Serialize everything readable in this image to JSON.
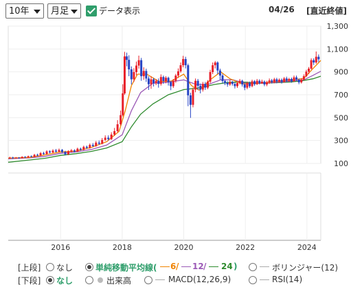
{
  "toolbar": {
    "range_value": "10年",
    "period_value": "月足",
    "data_display_label": "データ表示",
    "date": "04/26",
    "price_basis": "[直近終値]"
  },
  "chart_data": {
    "type": "candlestick",
    "ylim": [
      100,
      1300
    ],
    "yticks": [
      "1,300",
      "1,100",
      "900",
      "700",
      "500",
      "300",
      "100"
    ],
    "xticks": [
      "2016",
      "2018",
      "2020",
      "2022",
      "2024"
    ],
    "x_start": 2014.3,
    "x_end": 2024.45,
    "series": [
      {
        "name": "6",
        "color": "#f08300"
      },
      {
        "name": "12",
        "color": "#9b59b6"
      },
      {
        "name": "24",
        "color": "#2e8b2e"
      }
    ],
    "candles": [
      [
        2014.35,
        148,
        152,
        140,
        158
      ],
      [
        2014.45,
        152,
        146,
        140,
        158
      ],
      [
        2014.55,
        146,
        151,
        142,
        156
      ],
      [
        2014.65,
        151,
        147,
        143,
        155
      ],
      [
        2014.75,
        147,
        158,
        144,
        162
      ],
      [
        2014.85,
        158,
        152,
        149,
        163
      ],
      [
        2014.95,
        152,
        163,
        150,
        168
      ],
      [
        2015.05,
        163,
        158,
        154,
        170
      ],
      [
        2015.15,
        158,
        175,
        155,
        183
      ],
      [
        2015.25,
        175,
        168,
        164,
        185
      ],
      [
        2015.35,
        168,
        190,
        165,
        200
      ],
      [
        2015.45,
        190,
        182,
        176,
        202
      ],
      [
        2015.55,
        182,
        205,
        178,
        215
      ],
      [
        2015.65,
        205,
        196,
        188,
        215
      ],
      [
        2015.75,
        196,
        212,
        190,
        224
      ],
      [
        2015.85,
        212,
        203,
        195,
        226
      ],
      [
        2015.95,
        203,
        218,
        198,
        230
      ],
      [
        2016.05,
        218,
        200,
        192,
        226
      ],
      [
        2016.15,
        200,
        180,
        170,
        210
      ],
      [
        2016.25,
        180,
        205,
        172,
        215
      ],
      [
        2016.35,
        205,
        214,
        196,
        226
      ],
      [
        2016.45,
        214,
        204,
        196,
        224
      ],
      [
        2016.55,
        204,
        228,
        200,
        238
      ],
      [
        2016.65,
        228,
        220,
        212,
        238
      ],
      [
        2016.75,
        220,
        245,
        214,
        255
      ],
      [
        2016.85,
        245,
        236,
        226,
        256
      ],
      [
        2016.95,
        236,
        262,
        230,
        274
      ],
      [
        2017.05,
        262,
        252,
        244,
        278
      ],
      [
        2017.15,
        252,
        282,
        246,
        296
      ],
      [
        2017.25,
        282,
        272,
        262,
        300
      ],
      [
        2017.35,
        272,
        305,
        266,
        322
      ],
      [
        2017.45,
        305,
        325,
        296,
        345
      ],
      [
        2017.55,
        325,
        312,
        300,
        345
      ],
      [
        2017.65,
        312,
        352,
        305,
        372
      ],
      [
        2017.75,
        352,
        382,
        340,
        410
      ],
      [
        2017.85,
        382,
        442,
        370,
        478
      ],
      [
        2017.95,
        442,
        522,
        430,
        562
      ],
      [
        2018.02,
        522,
        712,
        510,
        792
      ],
      [
        2018.08,
        712,
        1035,
        700,
        1075
      ],
      [
        2018.15,
        1035,
        1005,
        948,
        1068
      ],
      [
        2018.22,
        1005,
        922,
        862,
        1045
      ],
      [
        2018.3,
        922,
        835,
        790,
        948
      ],
      [
        2018.38,
        835,
        898,
        812,
        932
      ],
      [
        2018.46,
        898,
        955,
        870,
        990
      ],
      [
        2018.54,
        955,
        1002,
        928,
        1042
      ],
      [
        2018.62,
        1002,
        862,
        822,
        1022
      ],
      [
        2018.7,
        862,
        908,
        830,
        940
      ],
      [
        2018.78,
        908,
        842,
        812,
        928
      ],
      [
        2018.86,
        842,
        792,
        742,
        862
      ],
      [
        2018.94,
        792,
        835,
        752,
        862
      ],
      [
        2019.02,
        835,
        802,
        772,
        848
      ],
      [
        2019.1,
        802,
        822,
        784,
        838
      ],
      [
        2019.18,
        822,
        795,
        762,
        842
      ],
      [
        2019.26,
        795,
        855,
        780,
        878
      ],
      [
        2019.34,
        855,
        820,
        795,
        868
      ],
      [
        2019.42,
        820,
        848,
        800,
        862
      ],
      [
        2019.5,
        848,
        810,
        780,
        858
      ],
      [
        2019.58,
        810,
        775,
        740,
        822
      ],
      [
        2019.66,
        775,
        822,
        760,
        838
      ],
      [
        2019.74,
        822,
        868,
        805,
        882
      ],
      [
        2019.82,
        868,
        905,
        848,
        930
      ],
      [
        2019.9,
        905,
        958,
        892,
        982
      ],
      [
        2019.98,
        958,
        1012,
        940,
        1040
      ],
      [
        2020.06,
        1012,
        958,
        930,
        1032
      ],
      [
        2020.14,
        958,
        695,
        600,
        972
      ],
      [
        2020.22,
        695,
        612,
        498,
        718
      ],
      [
        2020.3,
        612,
        745,
        590,
        762
      ],
      [
        2020.38,
        745,
        822,
        722,
        842
      ],
      [
        2020.46,
        822,
        778,
        742,
        838
      ],
      [
        2020.54,
        778,
        745,
        712,
        798
      ],
      [
        2020.62,
        745,
        795,
        728,
        812
      ],
      [
        2020.7,
        795,
        762,
        742,
        812
      ],
      [
        2020.78,
        762,
        815,
        748,
        828
      ],
      [
        2020.86,
        815,
        898,
        802,
        918
      ],
      [
        2020.94,
        898,
        958,
        880,
        982
      ],
      [
        2021.02,
        958,
        982,
        930,
        995
      ],
      [
        2021.1,
        982,
        912,
        880,
        992
      ],
      [
        2021.18,
        912,
        868,
        832,
        928
      ],
      [
        2021.26,
        868,
        820,
        800,
        882
      ],
      [
        2021.34,
        820,
        802,
        784,
        832
      ],
      [
        2021.42,
        802,
        790,
        770,
        818
      ],
      [
        2021.5,
        790,
        812,
        778,
        828
      ],
      [
        2021.58,
        812,
        795,
        780,
        822
      ],
      [
        2021.66,
        795,
        775,
        755,
        808
      ],
      [
        2021.74,
        775,
        802,
        760,
        815
      ],
      [
        2021.82,
        802,
        822,
        790,
        838
      ],
      [
        2021.9,
        822,
        790,
        772,
        832
      ],
      [
        2021.98,
        790,
        762,
        740,
        802
      ],
      [
        2022.06,
        762,
        802,
        748,
        815
      ],
      [
        2022.14,
        802,
        775,
        760,
        815
      ],
      [
        2022.22,
        775,
        818,
        765,
        832
      ],
      [
        2022.3,
        818,
        792,
        778,
        828
      ],
      [
        2022.38,
        792,
        822,
        785,
        838
      ],
      [
        2022.46,
        822,
        800,
        790,
        835
      ],
      [
        2022.54,
        800,
        815,
        795,
        832
      ],
      [
        2022.62,
        815,
        790,
        775,
        825
      ],
      [
        2022.7,
        790,
        810,
        775,
        822
      ],
      [
        2022.78,
        810,
        825,
        795,
        842
      ],
      [
        2022.86,
        825,
        810,
        798,
        838
      ],
      [
        2022.94,
        810,
        835,
        800,
        848
      ],
      [
        2023.02,
        835,
        815,
        800,
        848
      ],
      [
        2023.1,
        815,
        830,
        805,
        842
      ],
      [
        2023.18,
        830,
        812,
        798,
        842
      ],
      [
        2023.26,
        812,
        842,
        805,
        855
      ],
      [
        2023.34,
        842,
        822,
        810,
        858
      ],
      [
        2023.42,
        822,
        838,
        812,
        848
      ],
      [
        2023.5,
        838,
        818,
        805,
        850
      ],
      [
        2023.58,
        818,
        852,
        812,
        868
      ],
      [
        2023.66,
        852,
        832,
        820,
        868
      ],
      [
        2023.74,
        832,
        808,
        792,
        842
      ],
      [
        2023.82,
        808,
        832,
        798,
        845
      ],
      [
        2023.9,
        832,
        862,
        825,
        878
      ],
      [
        2023.98,
        862,
        902,
        855,
        918
      ],
      [
        2024.06,
        902,
        928,
        880,
        942
      ],
      [
        2024.14,
        928,
        1002,
        920,
        1018
      ],
      [
        2024.22,
        1002,
        982,
        960,
        1018
      ],
      [
        2024.3,
        982,
        1032,
        970,
        1078
      ],
      [
        2024.38,
        1032,
        1010,
        985,
        1052
      ]
    ],
    "sma6": [
      [
        2014.3,
        146
      ],
      [
        2015.0,
        152
      ],
      [
        2015.5,
        175
      ],
      [
        2016.0,
        200
      ],
      [
        2016.5,
        208
      ],
      [
        2017.0,
        240
      ],
      [
        2017.5,
        290
      ],
      [
        2017.9,
        380
      ],
      [
        2018.1,
        560
      ],
      [
        2018.3,
        780
      ],
      [
        2018.5,
        880
      ],
      [
        2018.8,
        880
      ],
      [
        2019.2,
        815
      ],
      [
        2019.6,
        820
      ],
      [
        2020.0,
        880
      ],
      [
        2020.25,
        780
      ],
      [
        2020.5,
        740
      ],
      [
        2020.9,
        840
      ],
      [
        2021.2,
        900
      ],
      [
        2021.5,
        840
      ],
      [
        2021.9,
        795
      ],
      [
        2022.4,
        800
      ],
      [
        2022.9,
        812
      ],
      [
        2023.4,
        826
      ],
      [
        2023.9,
        842
      ],
      [
        2024.2,
        930
      ],
      [
        2024.45,
        1000
      ]
    ],
    "sma12": [
      [
        2014.3,
        140
      ],
      [
        2015.0,
        148
      ],
      [
        2015.5,
        162
      ],
      [
        2016.0,
        188
      ],
      [
        2016.5,
        200
      ],
      [
        2017.0,
        222
      ],
      [
        2017.5,
        260
      ],
      [
        2018.0,
        350
      ],
      [
        2018.3,
        560
      ],
      [
        2018.6,
        720
      ],
      [
        2019.0,
        800
      ],
      [
        2019.5,
        810
      ],
      [
        2020.0,
        830
      ],
      [
        2020.4,
        790
      ],
      [
        2020.8,
        790
      ],
      [
        2021.2,
        830
      ],
      [
        2021.6,
        830
      ],
      [
        2022.0,
        800
      ],
      [
        2022.5,
        800
      ],
      [
        2023.0,
        808
      ],
      [
        2023.5,
        820
      ],
      [
        2023.9,
        830
      ],
      [
        2024.2,
        870
      ],
      [
        2024.45,
        905
      ]
    ],
    "sma24": [
      [
        2014.3,
        110
      ],
      [
        2015.0,
        130
      ],
      [
        2015.5,
        145
      ],
      [
        2016.0,
        170
      ],
      [
        2016.5,
        185
      ],
      [
        2017.0,
        205
      ],
      [
        2017.5,
        235
      ],
      [
        2018.0,
        290
      ],
      [
        2018.3,
        420
      ],
      [
        2018.6,
        530
      ],
      [
        2019.0,
        620
      ],
      [
        2019.5,
        700
      ],
      [
        2020.0,
        745
      ],
      [
        2020.5,
        760
      ],
      [
        2021.0,
        790
      ],
      [
        2021.5,
        810
      ],
      [
        2022.0,
        810
      ],
      [
        2022.5,
        800
      ],
      [
        2023.0,
        805
      ],
      [
        2023.5,
        812
      ],
      [
        2023.9,
        825
      ],
      [
        2024.2,
        840
      ],
      [
        2024.45,
        862
      ]
    ]
  },
  "options": {
    "upper_label": "[上段]",
    "upper_none": "なし",
    "upper_sma": "単純移動平均線(",
    "upper_sma_6": "6",
    "upper_sma_12": "12",
    "upper_sma_24": "24",
    "upper_sma_end": ")",
    "upper_bollinger": "ボリンジャー(12)",
    "lower_label": "[下段]",
    "lower_none": "なし",
    "lower_volume": "出来高",
    "lower_macd": "MACD(12,26,9)",
    "lower_rsi": "RSI(14)"
  }
}
